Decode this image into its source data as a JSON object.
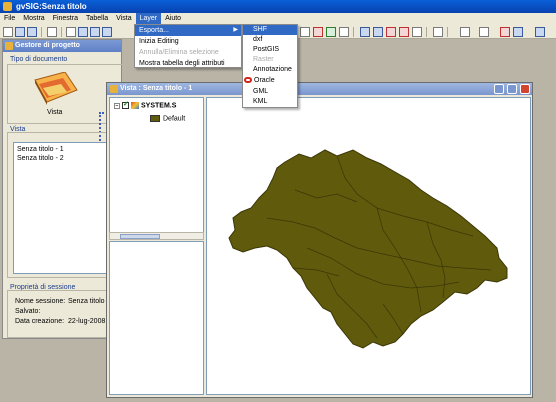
{
  "app": {
    "title": "gvSIG:Senza titolo"
  },
  "menubar": {
    "items": [
      "File",
      "Mostra",
      "Finestra",
      "Tabella",
      "Vista",
      "Layer",
      "Aiuto"
    ],
    "active_index": 5
  },
  "layer_menu": {
    "items": [
      {
        "label": "Esporta...",
        "state": "highlight",
        "submenu": true
      },
      {
        "label": "Inizia Editing",
        "state": "normal"
      },
      {
        "label": "Annulla/Elimina selezione",
        "state": "disabled"
      },
      {
        "label": "Mostra tabella degli attributi",
        "state": "normal"
      }
    ]
  },
  "export_menu": {
    "items": [
      {
        "label": "SHF",
        "state": "highlight"
      },
      {
        "label": "dxf",
        "state": "normal"
      },
      {
        "label": "PostGIS",
        "state": "normal"
      },
      {
        "label": "Raster",
        "state": "disabled"
      },
      {
        "label": "Annotazione",
        "state": "normal"
      },
      {
        "label": "Oracle",
        "state": "normal"
      },
      {
        "label": "GML",
        "state": "normal"
      },
      {
        "label": "KML",
        "state": "normal"
      }
    ]
  },
  "project_manager": {
    "title": "Gestore di progetto",
    "doc_type_label": "Tipo di documento",
    "doc_types": [
      {
        "label": "Vista"
      }
    ],
    "vista_label": "Vista",
    "views": [
      "Senza titolo - 1",
      "Senza titolo - 2"
    ],
    "session_props_label": "Proprietà di sessione",
    "session_name_label": "Nome sessione:",
    "session_name": "Senza titolo",
    "saved_label": "Salvato:",
    "saved_value": "",
    "created_label": "Data creazione:",
    "created_value": "22-lug-2008"
  },
  "view_window": {
    "title": "Vista : Senza titolo - 1",
    "toc": {
      "layer_name": "SYSTEM.S",
      "legend_label": "Default",
      "layer_checked": true
    }
  },
  "colors": {
    "map_fill": "#5f5a0c",
    "map_border": "#3a3606",
    "accent_blue": "#316ac5",
    "window_bg": "#ece9d8",
    "desktop_bg": "#b9b4a6"
  }
}
